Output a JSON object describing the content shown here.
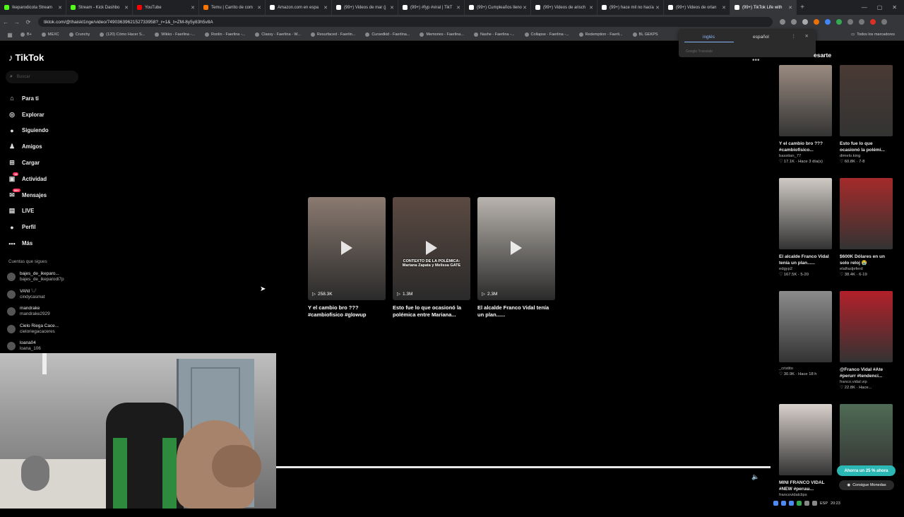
{
  "browser": {
    "tabs": [
      {
        "label": "Ikeparodicota Stream",
        "color": "#53fc18"
      },
      {
        "label": "Stream - Kick Dashbo",
        "color": "#53fc18"
      },
      {
        "label": "YouTube",
        "color": "#ff0000"
      },
      {
        "label": "Temu | Carrito de com",
        "color": "#fb7701"
      },
      {
        "label": "Amazon.com en espa",
        "color": "#ffffff"
      },
      {
        "label": "(99+) Videos de mar (j",
        "color": "#ffffff"
      },
      {
        "label": "(99+) #fyp #viral | TikT",
        "color": "#ffffff"
      },
      {
        "label": "(99+) Cumpleaños lleno",
        "color": "#ffffff"
      },
      {
        "label": "(99+) Videos de arisch",
        "color": "#ffffff"
      },
      {
        "label": "(99+) hace mil no hacía",
        "color": "#ffffff"
      },
      {
        "label": "(99+) Videos de orlan",
        "color": "#ffffff"
      },
      {
        "label": "(99+) TikTok Life with",
        "color": "#ffffff",
        "active": true
      }
    ],
    "url": "tiktok.com/@thaiskl1nge/video/7490363962152733958?_r=1&_t=ZM-8y5y83h5v8A",
    "bookmarks": [
      "B+",
      "MEXC",
      "Crunchy",
      "(120) Cómo Hacer S...",
      "Wikko - Faerlina -...",
      "Ronlin - Faerlina -...",
      "Classy - Faerlina - W...",
      "Resurfaced - Faerlin...",
      "Cursedkid - Faerlina...",
      "Memories - Faerlina...",
      "Nashe - Faerlina -...",
      "Collapse - Faerlina -...",
      "Redemption - Faerli...",
      "BL GEKPS"
    ],
    "bookmarks_right": "Todos los marcadores",
    "translate": {
      "lang1": "inglés",
      "lang2": "español",
      "footer": "Google Translate"
    }
  },
  "tiktok": {
    "logo": "TikTok",
    "search_placeholder": "Buscar",
    "menu": [
      {
        "icon": "home-icon",
        "glyph": "⌂",
        "label": "Para ti"
      },
      {
        "icon": "compass-icon",
        "glyph": "◎",
        "label": "Explorar"
      },
      {
        "icon": "following-icon",
        "glyph": "●",
        "label": "Siguiendo"
      },
      {
        "icon": "friends-icon",
        "glyph": "♟",
        "label": "Amigos"
      },
      {
        "icon": "upload-icon",
        "glyph": "⊞",
        "label": "Cargar"
      },
      {
        "icon": "activity-icon",
        "glyph": "▣",
        "label": "Actividad",
        "badge": "18"
      },
      {
        "icon": "messages-icon",
        "glyph": "✉",
        "label": "Mensajes",
        "badge": "99+"
      },
      {
        "icon": "live-icon",
        "glyph": "▤",
        "label": "LIVE"
      },
      {
        "icon": "profile-icon",
        "glyph": "●",
        "label": "Perfil"
      },
      {
        "icon": "more-icon",
        "glyph": "•••",
        "label": "Más"
      }
    ],
    "following_header": "Cuentas que sigues",
    "following": [
      {
        "name": "bajes_de_ikeparo...",
        "user": "bajes_de_ikeparodi7p"
      },
      {
        "name": "VANI 𓆩𓆪",
        "user": "cindycasmat"
      },
      {
        "name": "mandrake",
        "user": "mandrake2929"
      },
      {
        "name": "Cielo Riega Cace...",
        "user": "cieloriegacaceres"
      },
      {
        "name": "loana04",
        "user": "loana_106"
      }
    ],
    "videos": [
      {
        "views": "258.3K",
        "title": "Y el cambio bro ??? #cambiofisico #glowup",
        "color": "#8a7a70"
      },
      {
        "views": "1.3M",
        "title": "Esto fue lo que ocasionó la polémica entre Mariana...",
        "color": "#5b4a42",
        "caption": "CONTEXTO DE LA POLÉMICA: Mariana Zapata y Melissa GATE"
      },
      {
        "views": "2.3M",
        "title": "El alcalde Franco Vidal tenía un plan......",
        "color": "#b8b3ad"
      }
    ],
    "right_header": "esarte",
    "right": [
      {
        "title": "Y el cambio bro ??? #cambiofisico...",
        "author": "basstian_77",
        "meta": "♡ 17.1K · Hace 3 día(s)",
        "color": "#9a8b80"
      },
      {
        "title": "Esto fue lo que ocasionó la polémi...",
        "author": "dimelo.king",
        "meta": "♡ 60.8K · 7-8",
        "color": "#4a3a34"
      },
      {
        "title": "El alcalde Franco Vidal tenía un plan......",
        "author": "edgyp2",
        "meta": "♡ 167.5K · 5-20",
        "color": "#cfcac4"
      },
      {
        "title": "$600K Dólares en un solo reloj 😭",
        "author": "elalfasljeferd",
        "meta": "♡ 38.4K · 6-19",
        "color": "#a52a2a"
      },
      {
        "title": "",
        "author": "_cristito",
        "meta": "♡ 30.9K · Hace 18 h",
        "color": "#8c8c8c"
      },
      {
        "title": "@Franco Vidal #Ate #perurr #tendenci...",
        "author": "franco.vidal.vip",
        "meta": "♡ 22.8K · Hace...",
        "color": "#b3202a"
      },
      {
        "title": "MINI FRANCO VIDAL #NEW #peruш...",
        "author": "francovidalclips",
        "meta": "",
        "color": "#d8d0cb"
      },
      {
        "title": "",
        "author": "",
        "meta": "",
        "color": "#4f6b55"
      }
    ],
    "coin_promo": "Ahorra un 25 % ahora",
    "coin_button": "Consigue Monedas"
  },
  "taskbar": {
    "lang": "ESP",
    "time": "20:23"
  }
}
